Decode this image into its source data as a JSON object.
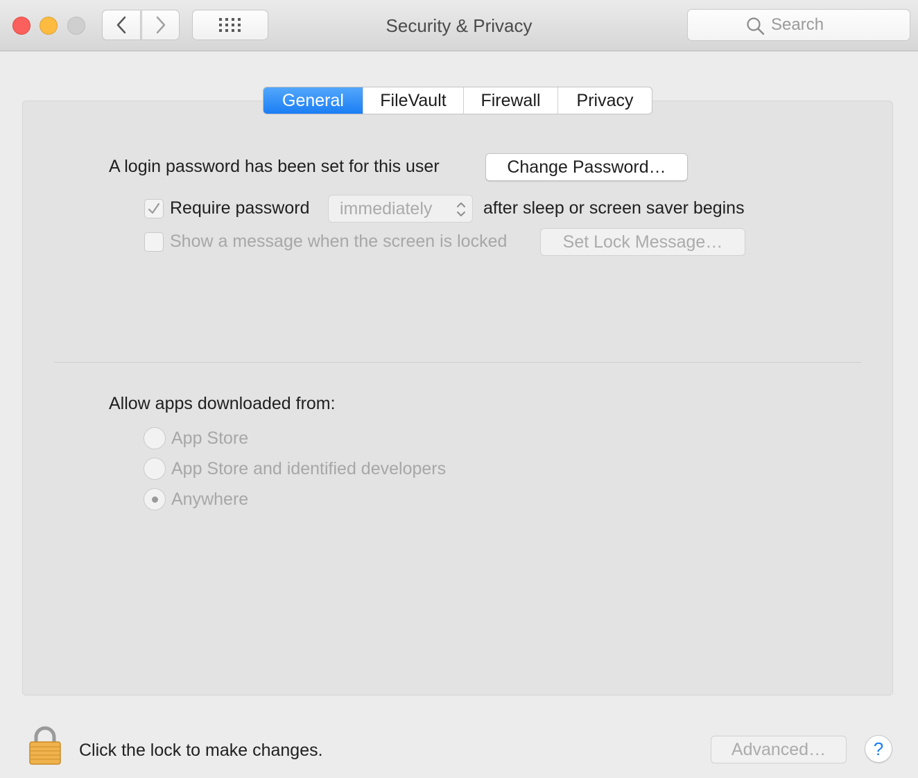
{
  "window": {
    "title": "Security & Privacy",
    "search_placeholder": "Search"
  },
  "tabs": [
    {
      "label": "General",
      "active": true
    },
    {
      "label": "FileVault",
      "active": false
    },
    {
      "label": "Firewall",
      "active": false
    },
    {
      "label": "Privacy",
      "active": false
    }
  ],
  "general": {
    "password_status": "A login password has been set for this user",
    "change_password_label": "Change Password…",
    "require_password": {
      "checked": true,
      "label": "Require password",
      "delay_value": "immediately",
      "suffix": "after sleep or screen saver begins"
    },
    "lock_message": {
      "checked": false,
      "label": "Show a message when the screen is locked",
      "button_label": "Set Lock Message…"
    },
    "allow_apps": {
      "heading": "Allow apps downloaded from:",
      "options": [
        {
          "label": "App Store",
          "selected": false
        },
        {
          "label": "App Store and identified developers",
          "selected": false
        },
        {
          "label": "Anywhere",
          "selected": true
        }
      ]
    }
  },
  "footer": {
    "lock_text": "Click the lock to make changes.",
    "advanced_label": "Advanced…",
    "help_label": "?"
  },
  "colors": {
    "accent": "#1b7ef4",
    "close": "#fc605c",
    "minimize": "#fdbc40",
    "zoom_disabled": "#cfcfcf",
    "lock_body": "#f0b24c"
  }
}
